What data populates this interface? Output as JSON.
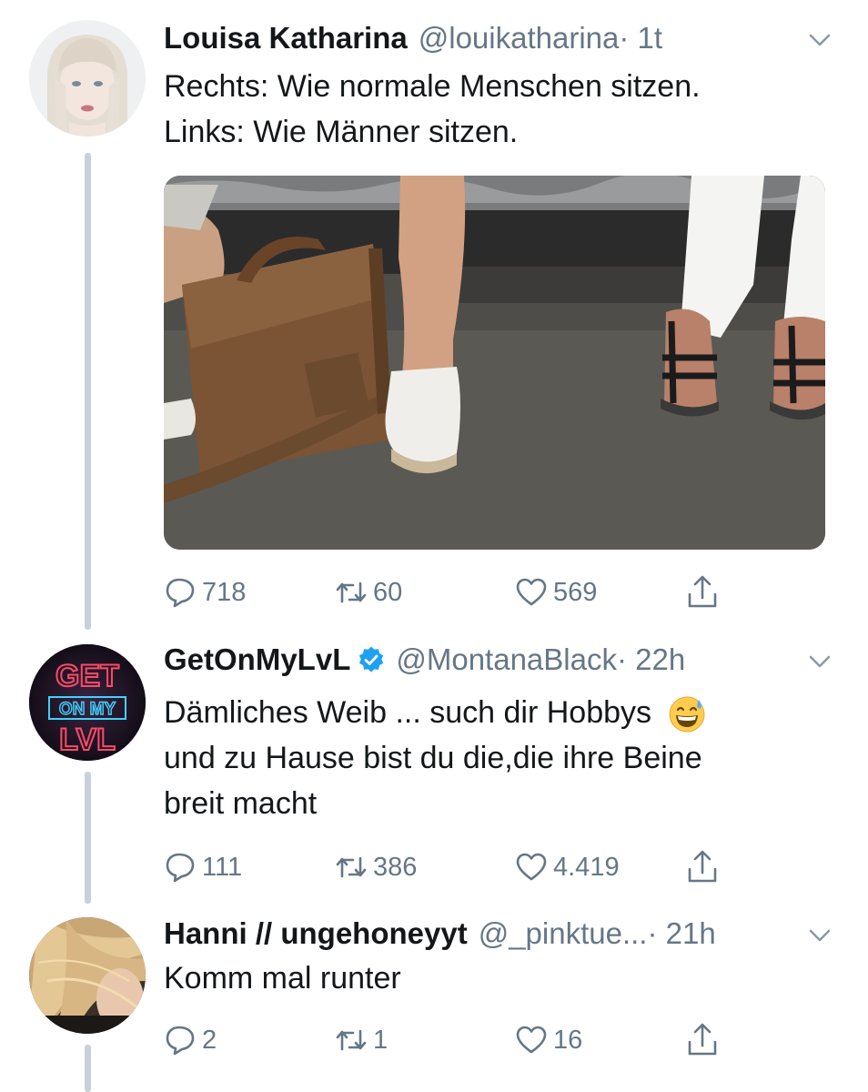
{
  "tweets": [
    {
      "name": "Louisa Katharina",
      "handle": "@louikatharina",
      "time": "· 1t",
      "lines": [
        "Rechts: Wie normale Menschen sitzen.",
        "Links: Wie Männer sitzen."
      ],
      "reply_count": "718",
      "retweet_count": "60",
      "like_count": "569"
    },
    {
      "name": "GetOnMyLvL",
      "handle": "@MontanaBlack",
      "time": "· 22h",
      "verified": true,
      "lines": [
        "Dämliches Weib ... such dir Hobbys",
        "und zu Hause bist du die,die ihre Beine",
        "breit macht"
      ],
      "avatar_text": [
        "GET",
        "ON MY",
        "LVL"
      ],
      "reply_count": "111",
      "retweet_count": "386",
      "like_count": "4.419"
    },
    {
      "name": "Hanni // ungehoneyyt",
      "handle": "@_pinktue...",
      "time": "· 21h",
      "lines": [
        "Komm mal runter"
      ],
      "reply_count": "2",
      "retweet_count": "1",
      "like_count": "16"
    }
  ],
  "colors": {
    "text": "#14171a",
    "secondary": "#657786",
    "thread_line": "#c8d1d9",
    "verified": "#1da1f2"
  },
  "icons": [
    "reply-icon",
    "retweet-icon",
    "like-icon",
    "share-icon",
    "chevron-down-icon",
    "verified-badge-icon",
    "grinning-sweat-emoji"
  ]
}
